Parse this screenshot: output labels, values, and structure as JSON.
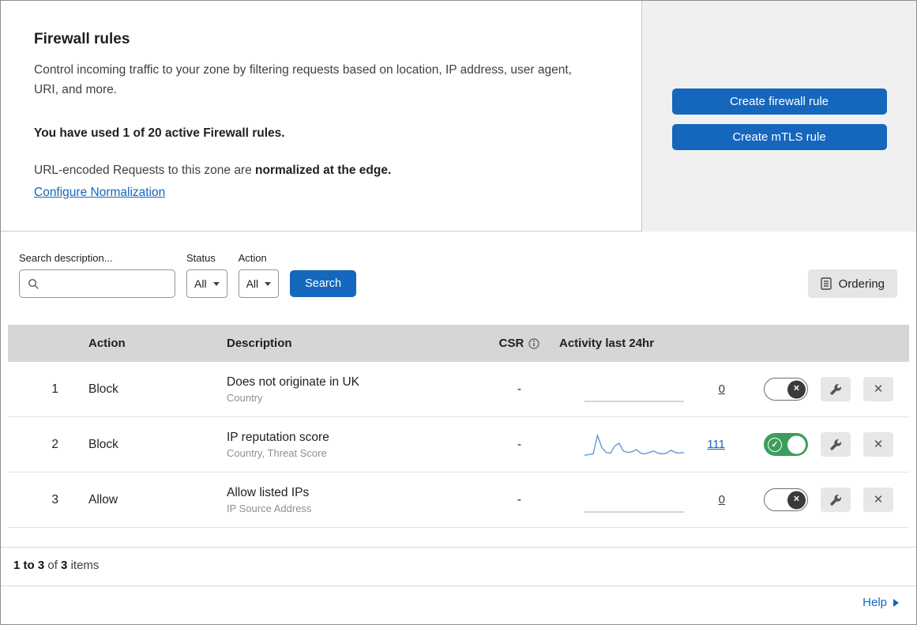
{
  "colors": {
    "accent_blue": "#1566bd",
    "toggle_green": "#3d9d5d",
    "panel_bg": "#f0f0f0",
    "table_header_bg": "#d6d6d6"
  },
  "icons": {
    "check": "✓",
    "close": "✕"
  },
  "intro": {
    "title": "Firewall rules",
    "description": "Control incoming traffic to your zone by filtering requests based on location, IP address, user agent, URI, and more.",
    "usage": "You have used 1 of 20 active Firewall rules.",
    "normalization_prefix": "URL-encoded Requests to this zone are ",
    "normalization_bold": "normalized at the edge.",
    "normalization_link": "Configure Normalization",
    "create_firewall_button": "Create firewall rule",
    "create_mtls_button": "Create mTLS rule"
  },
  "filters": {
    "search_label": "Search description...",
    "status_label": "Status",
    "status_value": "All",
    "action_label": "Action",
    "action_value": "All",
    "search_button": "Search",
    "ordering_button": "Ordering"
  },
  "table": {
    "columns": {
      "action": "Action",
      "description": "Description",
      "csr": "CSR",
      "activity": "Activity last 24hr"
    },
    "rows": [
      {
        "num": "1",
        "action": "Block",
        "description": "Does not originate in UK",
        "fields": "Country",
        "csr": "-",
        "count": "0",
        "enabled": false,
        "activity_24h": [
          0,
          0,
          0,
          0,
          0,
          0,
          0,
          0,
          0,
          0,
          0,
          0
        ]
      },
      {
        "num": "2",
        "action": "Block",
        "description": "IP reputation score",
        "fields": "Country, Threat Score",
        "csr": "-",
        "count": "111",
        "enabled": true,
        "activity_24h": [
          2,
          3,
          4,
          30,
          13,
          6,
          5,
          15,
          19,
          8,
          6,
          7,
          10,
          5,
          4,
          6,
          8,
          5,
          4,
          5,
          9,
          6,
          5,
          6
        ]
      },
      {
        "num": "3",
        "action": "Allow",
        "description": "Allow listed IPs",
        "fields": "IP Source Address",
        "csr": "-",
        "count": "0",
        "enabled": false,
        "activity_24h": [
          0,
          0,
          0,
          0,
          0,
          0,
          0,
          0,
          0,
          0,
          0,
          0
        ]
      }
    ]
  },
  "footer": {
    "range": "1 to 3",
    "of": "of",
    "total": "3",
    "items": "items"
  },
  "help": {
    "label": "Help"
  }
}
